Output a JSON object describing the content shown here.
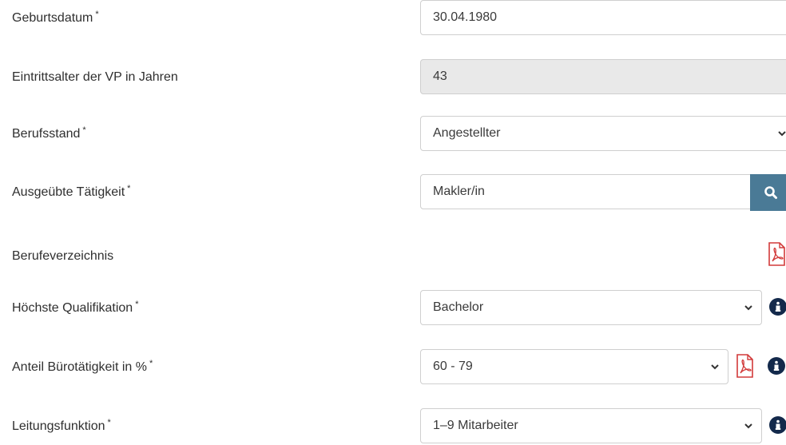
{
  "fields": {
    "birthdate": {
      "label": "Geburtsdatum",
      "required": "*",
      "value": "30.04.1980"
    },
    "entry_age": {
      "label": "Eintrittsalter der VP in Jahren",
      "value": "43"
    },
    "profession_status": {
      "label": "Berufsstand",
      "required": "*",
      "value": "Angestellter"
    },
    "occupation": {
      "label": "Ausgeübte Tätigkeit",
      "required": "*",
      "value": "Makler/in"
    },
    "directory": {
      "label": "Berufeverzeichnis"
    },
    "qualification": {
      "label": "Höchste Qualifikation",
      "required": "*",
      "value": "Bachelor"
    },
    "office_share": {
      "label": "Anteil Bürotätigkeit in %",
      "required": "*",
      "value": "60 - 79"
    },
    "leadership": {
      "label": "Leitungsfunktion",
      "required": "*",
      "value": "1–9 Mitarbeiter"
    }
  },
  "icons": {
    "search": "search-icon",
    "pdf": "pdf-icon",
    "info": "info-icon",
    "dropdown": "chevron-down-icon"
  },
  "colors": {
    "search_button": "#4a7a96",
    "info_icon": "#13294b",
    "pdf_icon": "#d23a3a"
  }
}
